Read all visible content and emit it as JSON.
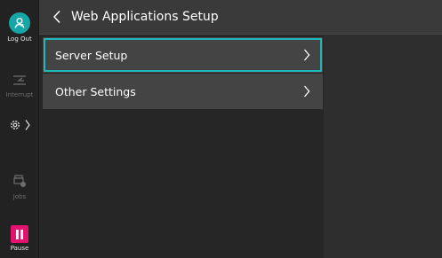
{
  "sidebar": {
    "logout_label": "Log Out",
    "interrupt_label": "Interrupt",
    "jobs_label": "Jobs",
    "pause_label": "Pause"
  },
  "header": {
    "title": "Web Applications Setup"
  },
  "menu": {
    "items": [
      {
        "label": "Server Setup"
      },
      {
        "label": "Other Settings"
      }
    ]
  },
  "colors": {
    "accent": "#1fb8b8",
    "logout": "#17a6a6",
    "pause": "#e2136e"
  }
}
